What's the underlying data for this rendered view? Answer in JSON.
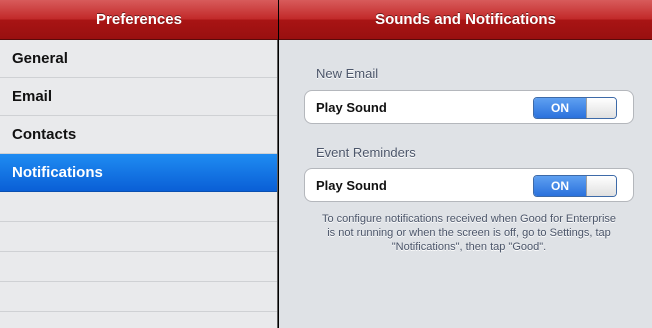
{
  "master": {
    "title": "Preferences",
    "items": [
      {
        "label": "General",
        "selected": false
      },
      {
        "label": "Email",
        "selected": false
      },
      {
        "label": "Contacts",
        "selected": false
      },
      {
        "label": "Notifications",
        "selected": true
      }
    ]
  },
  "detail": {
    "title": "Sounds and Notifications",
    "sections": [
      {
        "header": "New Email",
        "row_label": "Play Sound",
        "toggle": "ON"
      },
      {
        "header": "Event Reminders",
        "row_label": "Play Sound",
        "toggle": "ON"
      }
    ],
    "footnote": "To configure notifications received when Good for Enterprise is not running or when the screen is off, go to Settings, tap \"Notifications\", then tap \"Good\"."
  },
  "colors": {
    "navbar_red": "#c22a2a",
    "selection_blue": "#1f8cf2",
    "toggle_blue": "#2a71dd"
  }
}
